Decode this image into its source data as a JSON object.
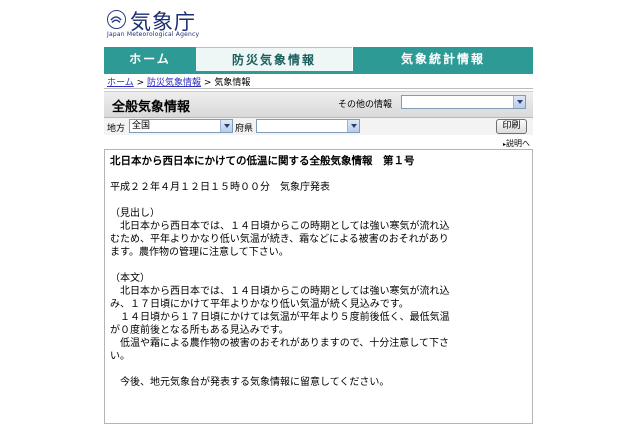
{
  "logo": {
    "name": "気象庁",
    "sub": "Japan Meteorological Agency"
  },
  "nav": {
    "tabs": [
      {
        "label": "ホーム"
      },
      {
        "label": "防災気象情報"
      },
      {
        "label": "気象統計情報"
      }
    ]
  },
  "breadcrumb": {
    "items": [
      "ホーム",
      "防災気象情報",
      "気象情報"
    ],
    "separator": ">"
  },
  "title_bar": {
    "title": "全般気象情報",
    "other_label": "その他の情報",
    "other_value": ""
  },
  "filters": {
    "region_label": "地方",
    "region_value": "全国",
    "pref_label": "府県",
    "pref_value": "",
    "print_label": "印刷",
    "help_label": "説明へ"
  },
  "content": {
    "heading": "北日本から西日本にかけての低温に関する全般気象情報　第１号",
    "issued": "平成２２年４月１２日１５時００分　気象庁発表",
    "summary_label": "（見出し）",
    "summary_lines": [
      "　北日本から西日本では、１４日頃からこの時期としては強い寒気が流れ込",
      "むため、平年よりかなり低い気温が続き、霜などによる被害のおそれがあり",
      "ます。農作物の管理に注意して下さい。"
    ],
    "body_label": "（本文）",
    "body_lines": [
      "　北日本から西日本では、１４日頃からこの時期としては強い寒気が流れ込",
      "み、１７日頃にかけて平年よりかなり低い気温が続く見込みです。",
      "　１４日頃から１７日頃にかけては気温が平年より５度前後低く、最低気温",
      "が０度前後となる所もある見込みです。",
      "　低温や霜による農作物の被害のおそれがありますので、十分注意して下さ",
      "い。"
    ],
    "closing": "　今後、地元気象台が発表する気象情報に留意してください。"
  },
  "colors": {
    "nav_accent": "#2e9a95",
    "logo_blue": "#1d2f73",
    "link": "#2d2dbf"
  }
}
